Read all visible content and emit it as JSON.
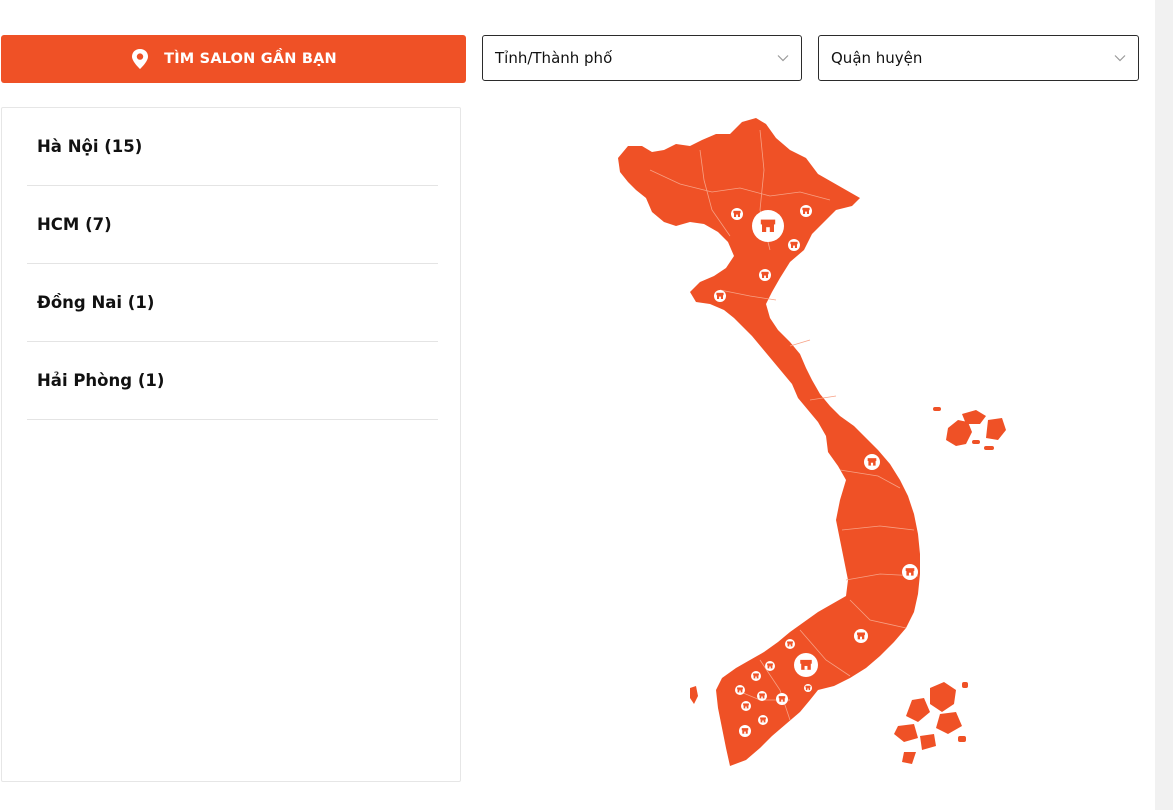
{
  "find_button": {
    "label": "TÌM SALON GẦN BẠN",
    "icon": "map-pin-icon"
  },
  "filters": {
    "city": {
      "value": "Tỉnh/Thành phố",
      "icon": "chevron-down-icon"
    },
    "district": {
      "value": "Quận huyện",
      "icon": "chevron-down-icon"
    }
  },
  "locations": [
    {
      "label": "Hà Nội (15)"
    },
    {
      "label": "HCM (7)"
    },
    {
      "label": "Đồng Nai (1)"
    },
    {
      "label": "Hải Phòng (1)"
    }
  ],
  "map": {
    "icon": "vietnam-map",
    "marker_icon": "salon-store-icon"
  },
  "colors": {
    "accent": "#ef5126",
    "text": "#111111",
    "border": "#e4e4e4"
  }
}
